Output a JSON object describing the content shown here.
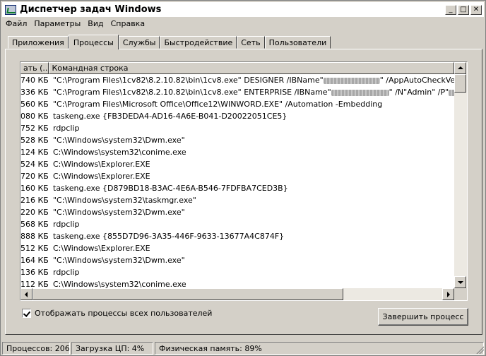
{
  "window": {
    "title": "Диспетчер задач Windows",
    "buttons": {
      "minimize": "_",
      "maximize": "□",
      "close": "✕"
    }
  },
  "menu": [
    "Файл",
    "Параметры",
    "Вид",
    "Справка"
  ],
  "tabs": [
    "Приложения",
    "Процессы",
    "Службы",
    "Быстродействие",
    "Сеть",
    "Пользователи"
  ],
  "active_tab": "Процессы",
  "columns": {
    "memory": "ать (...",
    "command": "Командная строка"
  },
  "processes": [
    {
      "mem": "740 КБ",
      "cmd_parts": [
        "\"C:\\Program Files\\1cv82\\8.2.10.82\\bin\\1cv8.exe\" DESIGNER /IBName\"",
        "\" /AppAutoCheckVersion /AppA"
      ],
      "redacted": true
    },
    {
      "mem": "336 КБ",
      "cmd_parts": [
        "\"C:\\Program Files\\1cv82\\8.2.10.82\\bin\\1cv8.exe\" ENTERPRISE /IBName\"",
        "\" /N\"Admin\" /P\"",
        "\"  /A"
      ],
      "redacted": true
    },
    {
      "mem": "560 КБ",
      "cmd": "\"C:\\Program Files\\Microsoft Office\\Office12\\WINWORD.EXE\" /Automation -Embedding"
    },
    {
      "mem": "080 КБ",
      "cmd": "taskeng.exe {FB3DEDA4-AD16-4A6E-B041-D20022051CE5}"
    },
    {
      "mem": "752 КБ",
      "cmd": "rdpclip"
    },
    {
      "mem": "528 КБ",
      "cmd": "\"C:\\Windows\\system32\\Dwm.exe\""
    },
    {
      "mem": "124 КБ",
      "cmd": "C:\\Windows\\system32\\conime.exe"
    },
    {
      "mem": "524 КБ",
      "cmd": "C:\\Windows\\Explorer.EXE"
    },
    {
      "mem": "720 КБ",
      "cmd": "C:\\Windows\\Explorer.EXE"
    },
    {
      "mem": "160 КБ",
      "cmd": "taskeng.exe {D879BD18-B3AC-4E6A-B546-7FDFBA7CED3B}"
    },
    {
      "mem": "216 КБ",
      "cmd": "\"C:\\Windows\\system32\\taskmgr.exe\""
    },
    {
      "mem": "220 КБ",
      "cmd": "\"C:\\Windows\\system32\\Dwm.exe\""
    },
    {
      "mem": "568 КБ",
      "cmd": "rdpclip"
    },
    {
      "mem": "888 КБ",
      "cmd": "taskeng.exe {855D7D96-3A35-446F-9633-13677A4C874F}"
    },
    {
      "mem": "512 КБ",
      "cmd": "C:\\Windows\\Explorer.EXE"
    },
    {
      "mem": "164 КБ",
      "cmd": "\"C:\\Windows\\system32\\Dwm.exe\""
    },
    {
      "mem": "136 КБ",
      "cmd": "rdpclip"
    },
    {
      "mem": "112 КБ",
      "cmd": "C:\\Windows\\system32\\conime.exe"
    }
  ],
  "show_all_processes": {
    "label": "Отображать процессы всех пользователей",
    "checked": true
  },
  "end_process_button": "Завершить процесс",
  "status": {
    "processes": "Процессов: 206",
    "cpu": "Загрузка ЦП: 4%",
    "memory": "Физическая память: 89%"
  }
}
